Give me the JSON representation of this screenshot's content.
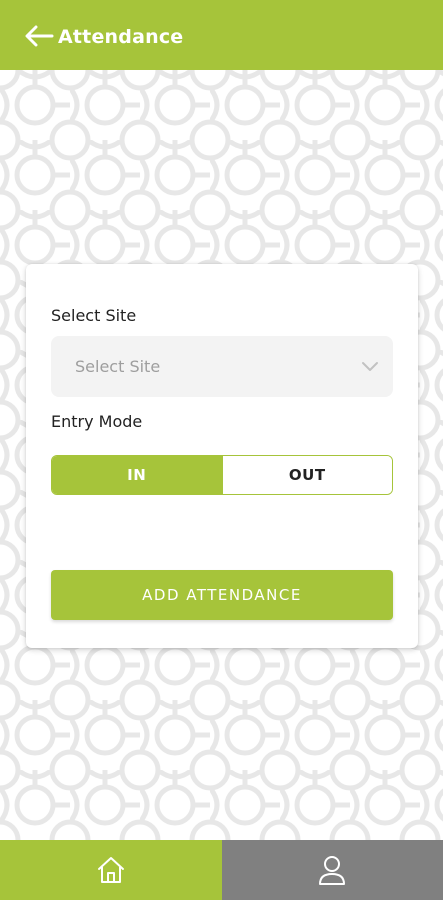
{
  "app_bar": {
    "title": "Attendance",
    "back_icon": "arrow-left-icon",
    "color": "#a6c43a"
  },
  "form": {
    "site_label": "Select Site",
    "site_select": {
      "placeholder": "Select Site",
      "icon": "chevron-down-icon"
    },
    "entry_mode_label": "Entry Mode",
    "entry_mode": {
      "options": [
        "IN",
        "OUT"
      ],
      "selected": "IN"
    },
    "submit_label": "ADD ATTENDANCE"
  },
  "bottom_nav": {
    "items": [
      {
        "icon": "home-icon",
        "active": true,
        "color": "#a6c43a"
      },
      {
        "icon": "user-icon",
        "active": false,
        "color": "#808080"
      }
    ]
  },
  "colors": {
    "accent": "#a6c43a",
    "inactive_tab": "#808080",
    "input_bg": "#f3f3f3"
  }
}
